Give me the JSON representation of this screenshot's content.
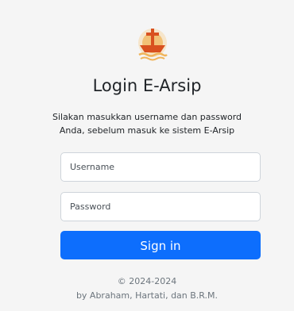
{
  "header": {
    "logo_icon": "church-cross-ship-logo-icon",
    "title": "Login E-Arsip",
    "subtitle_line1": "Silakan masukkan username dan password",
    "subtitle_line2": "Anda, sebelum masuk ke sistem E-Arsip"
  },
  "form": {
    "username_placeholder": "Username",
    "username_value": "",
    "password_placeholder": "Password",
    "password_value": "",
    "signin_label": "Sign in"
  },
  "footer": {
    "copyright": "© 2024-2024",
    "credits": "by Abraham, Hartati, dan B.R.M."
  },
  "colors": {
    "panel_background": "#f5f5f5",
    "primary_button": "#0d6efd",
    "logo_primary": "#d9511f",
    "logo_secondary": "#f0b45a"
  }
}
